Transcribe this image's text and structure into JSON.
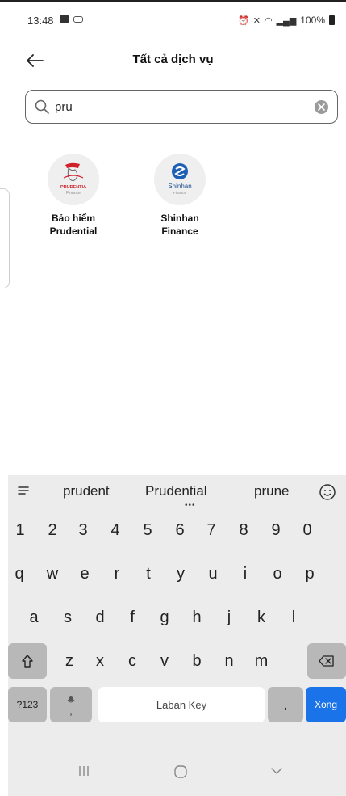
{
  "status_bar": {
    "time": "13:48",
    "battery": "100%"
  },
  "header": {
    "title": "Tất cả dịch vụ"
  },
  "search": {
    "value": "pru",
    "placeholder": ""
  },
  "services": [
    {
      "line1": "Bảo hiểm",
      "line2": "Prudential",
      "logo_text": "PRUDENTIA",
      "logo_sub": "Finance"
    },
    {
      "line1": "Shinhan",
      "line2": "Finance",
      "logo_text": "Shinhan",
      "logo_sub": "Finance"
    }
  ],
  "keyboard": {
    "suggestions": [
      "prudent",
      "Prudential",
      "prune"
    ],
    "number_row": [
      "1",
      "2",
      "3",
      "4",
      "5",
      "6",
      "7",
      "8",
      "9",
      "0"
    ],
    "row1": [
      "q",
      "w",
      "e",
      "r",
      "t",
      "y",
      "u",
      "i",
      "o",
      "p"
    ],
    "row2": [
      "a",
      "s",
      "d",
      "f",
      "g",
      "h",
      "j",
      "k",
      "l"
    ],
    "row3": [
      "z",
      "x",
      "c",
      "v",
      "b",
      "n",
      "m"
    ],
    "symbols_label": "?123",
    "comma_label": ",",
    "space_label": "Laban Key",
    "period_label": ".",
    "done_label": "Xong"
  },
  "colors": {
    "accent": "#1a73e8",
    "keyboard_bg": "#ececec",
    "dark_key": "#b8b8b8"
  }
}
